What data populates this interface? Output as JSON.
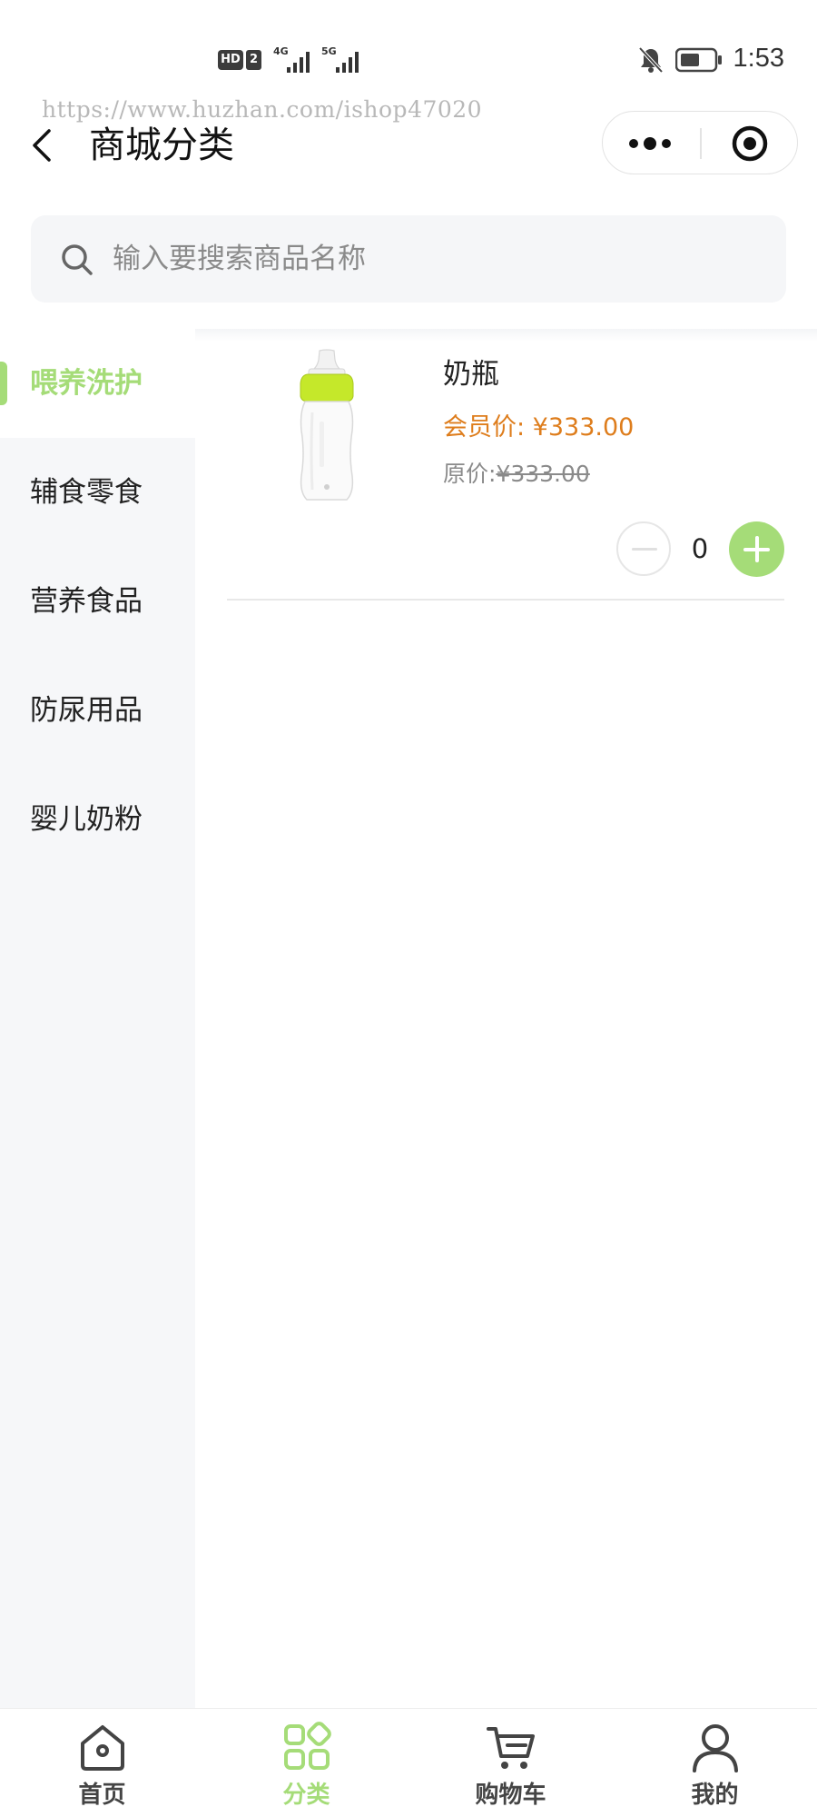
{
  "status_bar": {
    "hd": "HD",
    "sim": "2",
    "net1": "4G",
    "net2": "5G",
    "time": "1:53"
  },
  "watermark": "https://www.huzhan.com/ishop47020",
  "nav": {
    "title": "商城分类"
  },
  "search": {
    "placeholder": "输入要搜索商品名称",
    "value": ""
  },
  "categories": [
    {
      "label": "喂养洗护",
      "active": true
    },
    {
      "label": "辅食零食",
      "active": false
    },
    {
      "label": "营养食品",
      "active": false
    },
    {
      "label": "防尿用品",
      "active": false
    },
    {
      "label": "婴儿奶粉",
      "active": false
    }
  ],
  "products": [
    {
      "name": "奶瓶",
      "member_price": "会员价: ¥333.00",
      "original_label": "原价:",
      "original_price": "¥333.00",
      "quantity": "0"
    }
  ],
  "tabs": [
    {
      "label": "首页",
      "icon": "home-icon",
      "active": false
    },
    {
      "label": "分类",
      "icon": "category-icon",
      "active": true
    },
    {
      "label": "购物车",
      "icon": "cart-icon",
      "active": false
    },
    {
      "label": "我的",
      "icon": "user-icon",
      "active": false
    }
  ],
  "colors": {
    "accent": "#a5dc78",
    "price": "#de7d1c",
    "sidebar_bg": "#f6f7f9"
  }
}
